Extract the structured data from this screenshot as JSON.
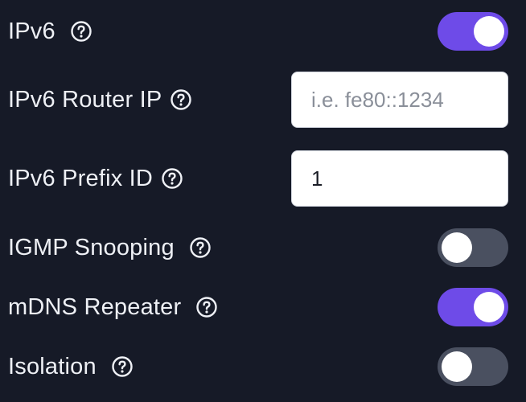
{
  "settings": [
    {
      "label": "IPv6",
      "type": "toggle",
      "enabled": true
    },
    {
      "label": "IPv6 Router IP",
      "type": "input",
      "value": "",
      "placeholder": "i.e. fe80::1234"
    },
    {
      "label": "IPv6 Prefix ID",
      "type": "input",
      "value": "1",
      "placeholder": ""
    },
    {
      "label": "IGMP Snooping",
      "type": "toggle",
      "enabled": false
    },
    {
      "label": "mDNS Repeater",
      "type": "toggle",
      "enabled": true
    },
    {
      "label": "Isolation",
      "type": "toggle",
      "enabled": false
    }
  ],
  "icons": {
    "help": "question-circle-icon"
  },
  "colors": {
    "background": "#161a27",
    "toggle_on": "#6e4be8",
    "toggle_off": "#4a5060",
    "text": "#eef0f5"
  }
}
